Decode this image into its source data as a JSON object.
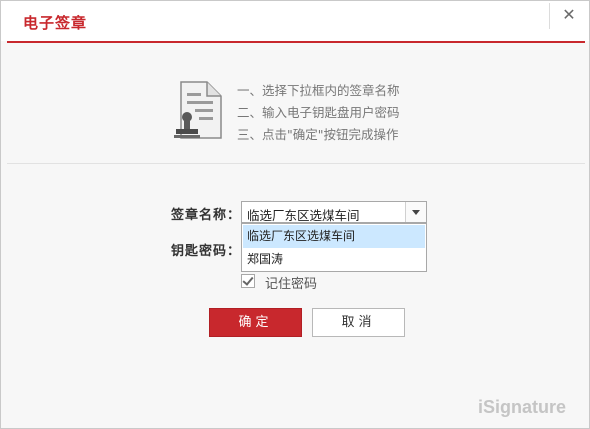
{
  "window": {
    "title": "电子签章",
    "close_glyph": "✕"
  },
  "instructions": [
    "一、选择下拉框内的签章名称",
    "二、输入电子钥匙盘用户密码",
    "三、点击\"确定\"按钮完成操作"
  ],
  "form": {
    "seal_label": "签章名称：",
    "seal_selected": "临选厂东区选煤车间",
    "seal_options": [
      "临选厂东区选煤车间",
      "郑国涛"
    ],
    "key_password_label": "钥匙密码：",
    "remember_label": "记住密码",
    "remember_checked": true
  },
  "buttons": {
    "ok": "确定",
    "cancel": "取消"
  },
  "brand": "iSignature",
  "colors": {
    "accent": "#c8282d",
    "highlight": "#cce8ff"
  },
  "icons": {
    "document": "document-seal-icon",
    "close": "close-icon",
    "dropdown": "chevron-down-icon",
    "checkbox": "check-icon"
  }
}
